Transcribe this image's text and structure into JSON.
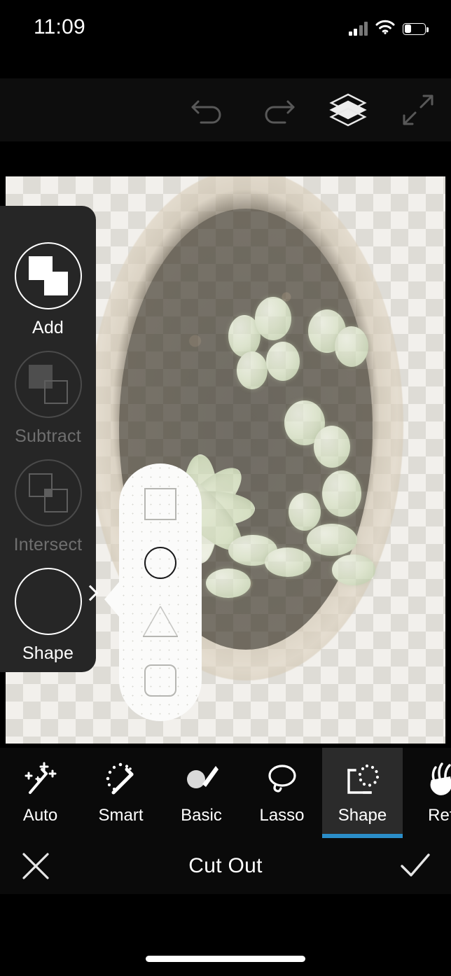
{
  "status_bar": {
    "time": "11:09",
    "cellular_icon": "cellular-signal-icon",
    "cellular_bars_active": 2,
    "cellular_bars_total": 4,
    "wifi_icon": "wifi-icon",
    "battery_icon": "battery-icon",
    "battery_level_percent": 35
  },
  "toolbar": {
    "buttons": [
      {
        "name": "undo-button",
        "icon": "undo-icon",
        "enabled": false
      },
      {
        "name": "redo-button",
        "icon": "redo-icon",
        "enabled": false
      },
      {
        "name": "layers-button",
        "icon": "layers-icon",
        "enabled": true
      },
      {
        "name": "fullscreen-button",
        "icon": "expand-arrows-icon",
        "enabled": false
      }
    ]
  },
  "canvas": {
    "content_description": "top-down photo of succulent plants in a pot over transparency checkerboard",
    "transparency_checker": true
  },
  "ops_panel": {
    "items": [
      {
        "label": "Add",
        "icon": "boolean-add-icon",
        "selected": true
      },
      {
        "label": "Subtract",
        "icon": "boolean-subtract-icon",
        "selected": false
      },
      {
        "label": "Intersect",
        "icon": "boolean-intersect-icon",
        "selected": false
      },
      {
        "label": "Shape",
        "icon": "shape-circle-icon",
        "selected": true,
        "has_submenu": true,
        "chevron": "chevron-right-icon"
      }
    ]
  },
  "shape_popover": {
    "options": [
      {
        "name": "shape-square",
        "icon": "square-icon",
        "selected": false
      },
      {
        "name": "shape-circle",
        "icon": "circle-icon",
        "selected": true
      },
      {
        "name": "shape-triangle",
        "icon": "triangle-icon",
        "selected": false
      },
      {
        "name": "shape-rounded-square",
        "icon": "rounded-square-icon",
        "selected": false
      }
    ]
  },
  "tool_tabs": {
    "active": "Shape",
    "accent_color": "#2b8ec9",
    "items": [
      {
        "label": "Auto",
        "icon": "magic-wand-sparkles-icon",
        "active": false
      },
      {
        "label": "Smart",
        "icon": "smart-wand-icon",
        "active": false
      },
      {
        "label": "Basic",
        "icon": "brush-icon",
        "active": false
      },
      {
        "label": "Lasso",
        "icon": "lasso-icon",
        "active": false
      },
      {
        "label": "Shape",
        "icon": "shape-selection-icon",
        "active": true
      },
      {
        "label": "Refi",
        "icon": "refine-hand-icon",
        "active": false
      }
    ]
  },
  "action_bar": {
    "cancel_icon": "close-x-icon",
    "title": "Cut Out",
    "confirm_icon": "checkmark-icon"
  },
  "home_indicator": {
    "name": "home-indicator"
  }
}
